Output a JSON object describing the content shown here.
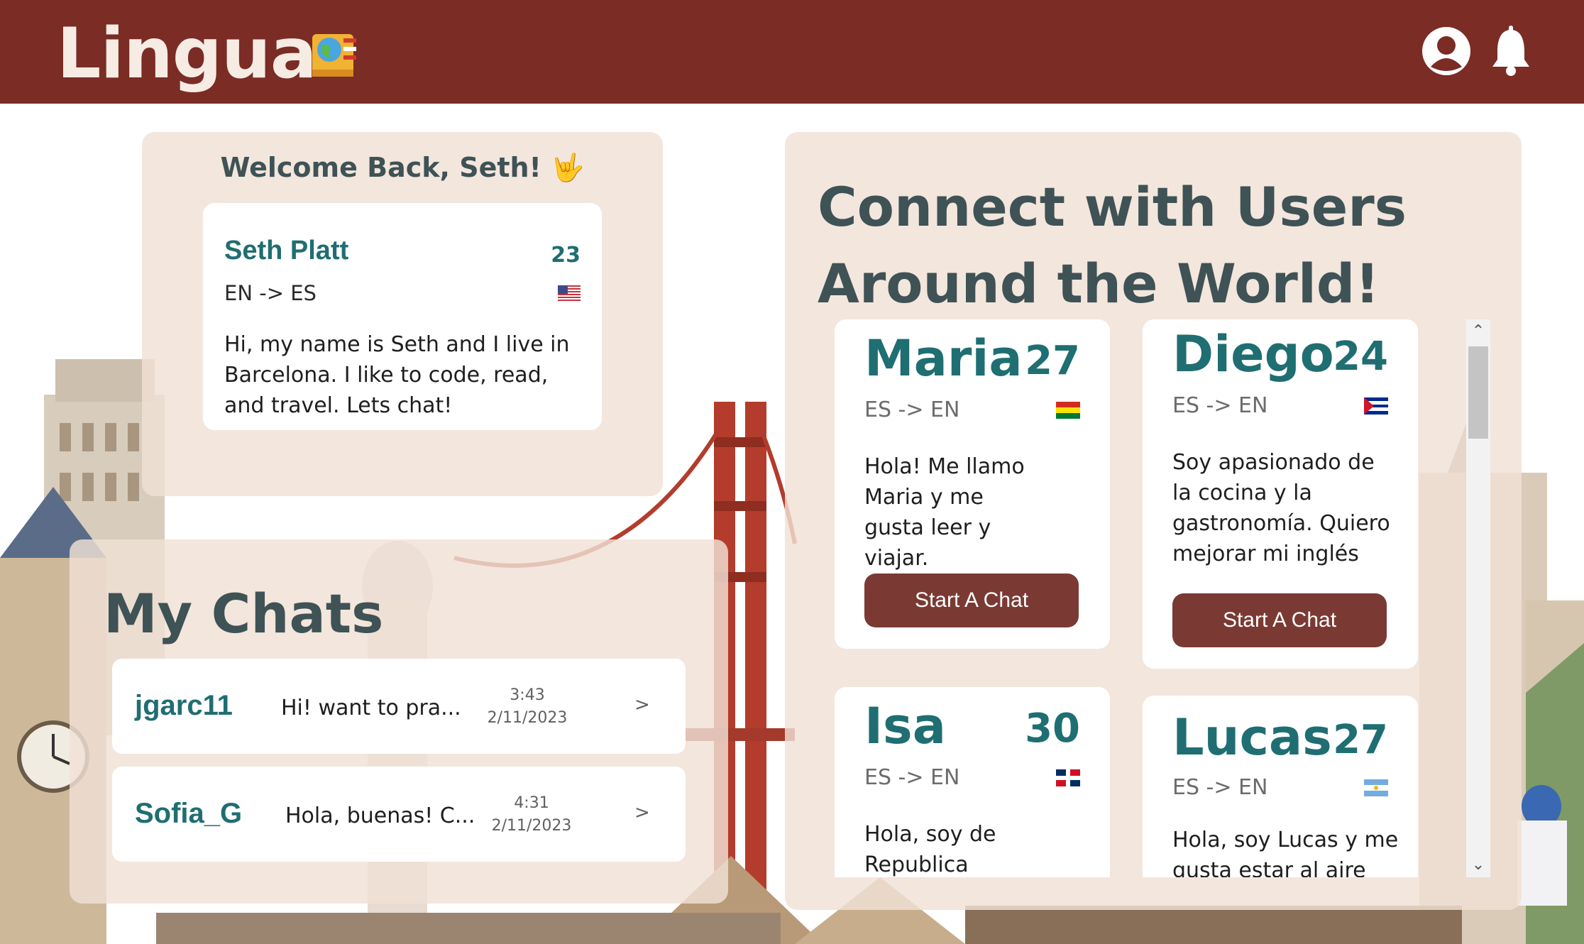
{
  "header": {
    "brand": "Lingua",
    "brand_icon": "book-globe-icon",
    "profile_icon": "user-circle-icon",
    "notifications_icon": "bell-icon",
    "colors": {
      "bar": "#7a2c25",
      "brand_text": "#f6ece4"
    }
  },
  "welcome": {
    "title": "Welcome Back, Seth! 🤟",
    "profile": {
      "name": "Seth Platt",
      "age": "23",
      "languages": "EN -> ES",
      "flag": "us-flag-icon",
      "bio": "Hi, my name is Seth and I live in Barcelona. I like to code, read, and travel. Lets chat!"
    }
  },
  "chats": {
    "title": "My Chats",
    "items": [
      {
        "name": "jgarc11",
        "preview": "Hi! want to pra...",
        "time": "3:43",
        "date": "2/11/2023",
        "action": ">"
      },
      {
        "name": "Sofia_G",
        "preview": "Hola, buenas! C...",
        "time": "4:31",
        "date": "2/11/2023",
        "action": ">"
      }
    ]
  },
  "connect": {
    "title_line1": "Connect with Users",
    "title_line2": "Around the World!",
    "users": [
      {
        "name": "Maria",
        "age": "27",
        "languages": "ES -> EN",
        "flag": "bolivia-flag-icon",
        "bio": "Hola! Me llamo Maria y me gusta leer y viajar.",
        "button": "Start A Chat"
      },
      {
        "name": "Diego",
        "age": "24",
        "languages": "ES -> EN",
        "flag": "cuba-flag-icon",
        "bio": "Soy apasionado de la cocina y la gastronomía. Quiero mejorar mi inglés",
        "button": "Start A Chat"
      },
      {
        "name": "Isa",
        "age": "30",
        "languages": "ES -> EN",
        "flag": "dominican-republic-flag-icon",
        "bio": "Hola, soy de Republica"
      },
      {
        "name": "Lucas",
        "age": "27",
        "languages": "ES -> EN",
        "flag": "argentina-flag-icon",
        "bio": "Hola, soy Lucas y me gusta estar al aire"
      }
    ]
  },
  "theme": {
    "accent_teal": "#1f6e72",
    "button": "#7a3a33",
    "heading": "#3f5255",
    "panel": "#f0e0d6"
  }
}
